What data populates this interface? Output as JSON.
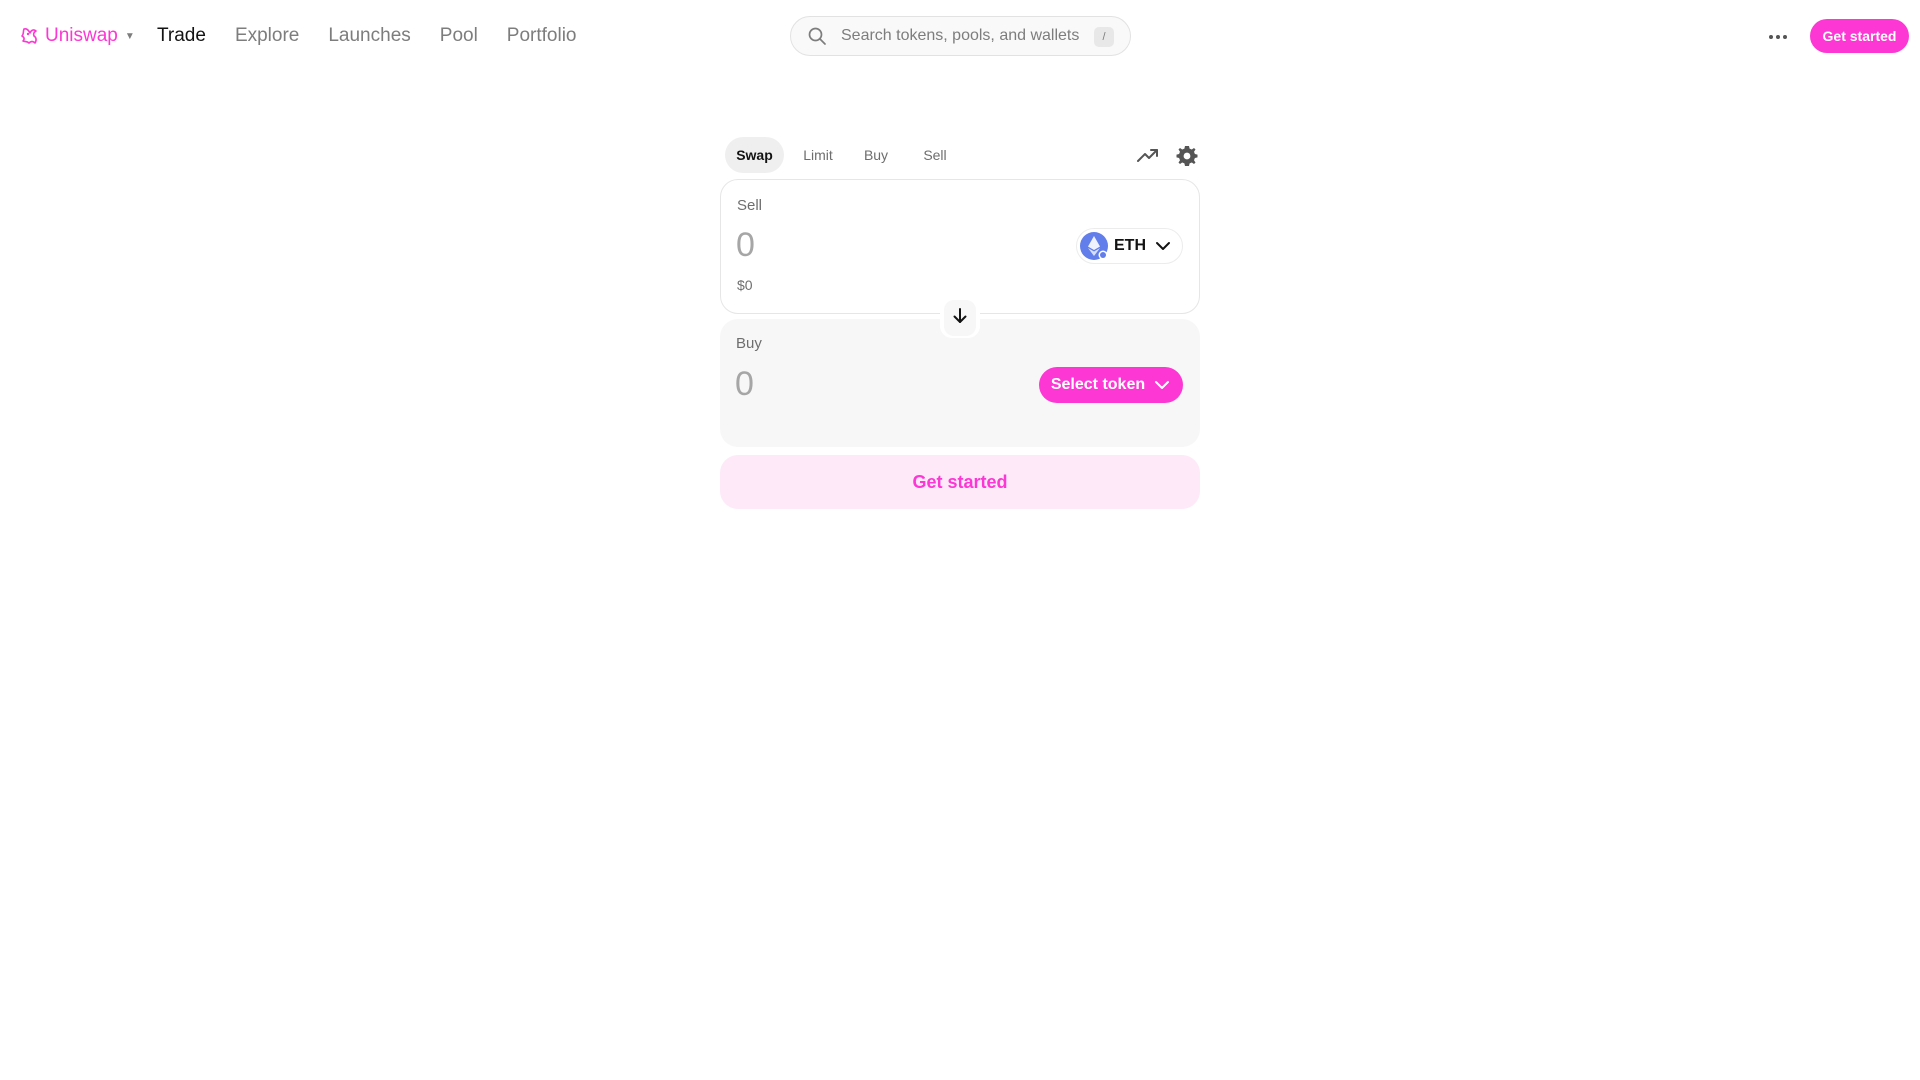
{
  "brand": {
    "name": "Uniswap",
    "accent_color": "#fc37d4"
  },
  "nav": {
    "items": [
      {
        "label": "Trade",
        "active": true
      },
      {
        "label": "Explore",
        "active": false
      },
      {
        "label": "Launches",
        "active": false
      },
      {
        "label": "Pool",
        "active": false
      },
      {
        "label": "Portfolio",
        "active": false
      }
    ]
  },
  "search": {
    "placeholder": "Search tokens, pools, and wallets",
    "shortcut": "/"
  },
  "header": {
    "more_icon": "ellipsis-icon",
    "cta_label": "Get started"
  },
  "swap": {
    "tabs": [
      {
        "label": "Swap",
        "active": true
      },
      {
        "label": "Limit",
        "active": false
      },
      {
        "label": "Buy",
        "active": false
      },
      {
        "label": "Sell",
        "active": false
      }
    ],
    "chart_icon": "trending-up-icon",
    "settings_icon": "gear-icon",
    "sell": {
      "label": "Sell",
      "amount_placeholder": "0",
      "usd_value": "$0",
      "token": "ETH"
    },
    "flip_icon": "arrow-down-icon",
    "buy": {
      "label": "Buy",
      "amount_placeholder": "0",
      "select_token_label": "Select token"
    },
    "cta_label": "Get started"
  }
}
